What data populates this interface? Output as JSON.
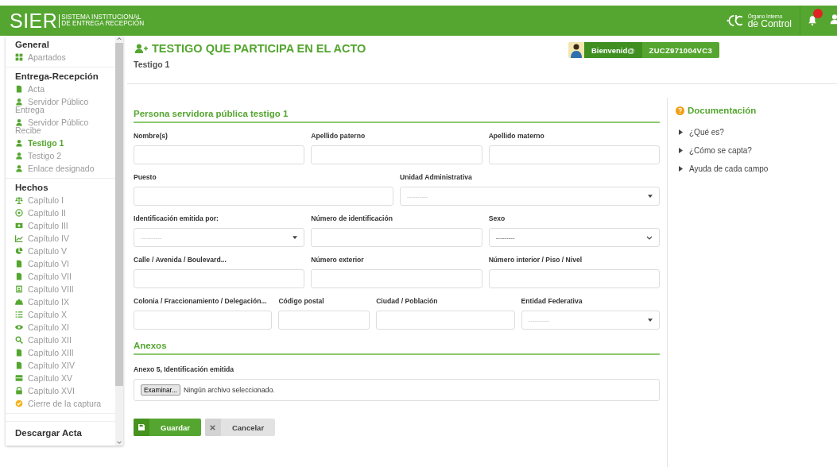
{
  "header": {
    "logo": "SIER",
    "logo_subtitle": [
      "SISTEMA INSTITUCIONAL",
      "DE ENTREGA RECEPCIÓN"
    ],
    "org_name": [
      "Órgano Interno",
      "de Control"
    ],
    "notifications": {
      "unread": true
    }
  },
  "sidebar": {
    "sections": [
      {
        "title": "General",
        "items": [
          {
            "label": "Apartados",
            "selected": false
          }
        ]
      },
      {
        "title": "Entrega-Recepción",
        "items": [
          {
            "label": "Acta",
            "selected": false
          },
          {
            "label": "Servidor Público Entrega",
            "selected": false
          },
          {
            "label": "Servidor Público Recibe",
            "selected": false
          },
          {
            "label": "Testigo 1",
            "selected": true
          },
          {
            "label": "Testigo 2",
            "selected": false
          },
          {
            "label": "Enlace designado",
            "selected": false
          }
        ]
      },
      {
        "title": "Hechos",
        "items": [
          {
            "label": "Capítulo I",
            "selected": false
          },
          {
            "label": "Capítulo II",
            "selected": false
          },
          {
            "label": "Capítulo III",
            "selected": false
          },
          {
            "label": "Capítulo IV",
            "selected": false
          },
          {
            "label": "Capítulo V",
            "selected": false
          },
          {
            "label": "Capítulo VI",
            "selected": false
          },
          {
            "label": "Capítulo VII",
            "selected": false
          },
          {
            "label": "Capítulo VIII",
            "selected": false
          },
          {
            "label": "Capítulo IX",
            "selected": false
          },
          {
            "label": "Capítulo X",
            "selected": false
          },
          {
            "label": "Capítulo XI",
            "selected": false
          },
          {
            "label": "Capítulo XII",
            "selected": false
          },
          {
            "label": "Capítulo XIII",
            "selected": false
          },
          {
            "label": "Capítulo XIV",
            "selected": false
          },
          {
            "label": "Capítulo XV",
            "selected": false
          },
          {
            "label": "Capítulo XVI",
            "selected": false
          },
          {
            "label": "Cierre de la captura",
            "selected": false
          }
        ]
      },
      {
        "title": "Descargar Acta"
      }
    ]
  },
  "page": {
    "title": "TESTIGO QUE PARTICIPA EN EL ACTO",
    "subtitle": "Testigo 1",
    "welcome": {
      "greeting": "Bienvenid@",
      "user": "ZUCZ971004VC3"
    }
  },
  "form": {
    "title": "Persona servidora pública testigo 1",
    "rows": [
      [
        {
          "label": "Nombre(s)",
          "kind": "text"
        },
        {
          "label": "Apellido paterno",
          "kind": "text"
        },
        {
          "label": "Apellido materno",
          "kind": "text"
        }
      ],
      [
        {
          "label": "Puesto",
          "kind": "text"
        },
        {
          "label": "Unidad Administrativa",
          "kind": "dropdown",
          "placeholder": "----------"
        }
      ],
      [
        {
          "label": "Identificación emitida por:",
          "kind": "dropdown",
          "placeholder": "----------"
        },
        {
          "label": "Número de identificación",
          "kind": "text"
        },
        {
          "label": "Sexo",
          "kind": "select",
          "value": "---------"
        }
      ],
      [
        {
          "label": "Calle / Avenida / Boulevard...",
          "kind": "text"
        },
        {
          "label": "Número exterior",
          "kind": "text"
        },
        {
          "label": "Número interior / Piso / Nivel",
          "kind": "text"
        }
      ],
      [
        {
          "label": "Colonia / Fraccionamiento / Delegación...",
          "kind": "text"
        },
        {
          "label": "Código postal",
          "kind": "text"
        },
        {
          "label": "Ciudad / Población",
          "kind": "text"
        },
        {
          "label": "Entidad Federativa",
          "kind": "dropdown",
          "placeholder": "----------"
        }
      ]
    ],
    "annex_title": "Anexos",
    "annex": {
      "label": "Anexo 5, Identificación emitida",
      "button": "Examinar...",
      "status": "Ningún archivo seleccionado."
    },
    "buttons": [
      {
        "label": "Guardar",
        "kind": "primary"
      },
      {
        "label": "Cancelar",
        "kind": "secondary"
      }
    ]
  },
  "docs": {
    "title": "Documentación",
    "items": [
      "¿Qué es?",
      "¿Cómo se capta?",
      "Ayuda de cada campo"
    ]
  }
}
